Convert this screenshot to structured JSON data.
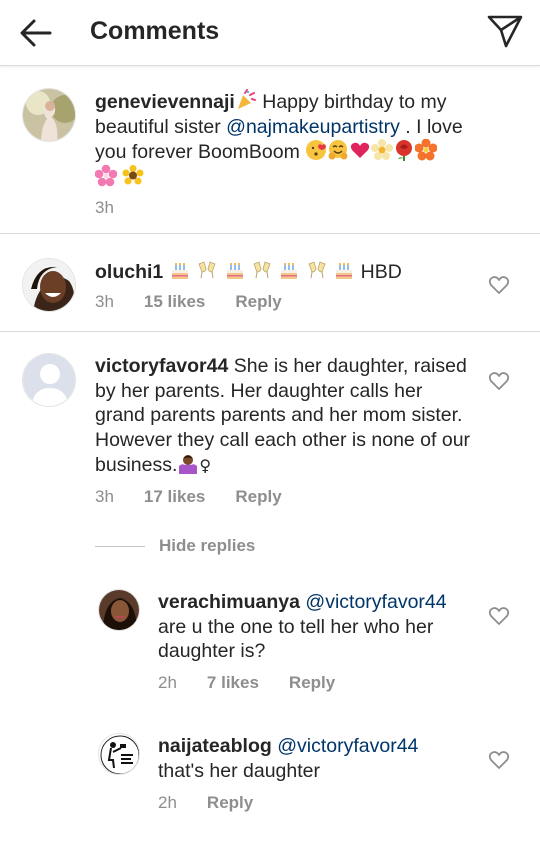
{
  "header": {
    "title": "Comments"
  },
  "caption": {
    "username": "genevievennaji",
    "text_before": " Happy birthday to my beautiful sister ",
    "mention": "@najmakeupartistry",
    "text_after": " . I love you forever BoomBoom ",
    "time": "3h"
  },
  "comments": [
    {
      "username": "oluchi1",
      "text": " HBD",
      "time": "3h",
      "likes": "15 likes",
      "reply": "Reply"
    },
    {
      "username": "victoryfavor44",
      "text": " She is her daughter, raised by her parents. Her daughter calls her grand parents parents and her mom sister. However they call each other is none of our business.",
      "time": "3h",
      "likes": "17 likes",
      "reply": "Reply"
    }
  ],
  "hide_replies": "Hide replies",
  "replies": [
    {
      "username": "verachimuanya",
      "mention": "@victoryfavor44",
      "text": "are u the one to tell her who her daughter is?",
      "time": "2h",
      "likes": "7 likes",
      "reply": "Reply"
    },
    {
      "username": "naijateablog",
      "mention": "@victoryfavor44",
      "text": "that's her daughter",
      "time": "2h",
      "reply": "Reply"
    }
  ],
  "icons": {
    "back": "arrow-left-icon",
    "send": "paper-plane-icon",
    "like": "heart-outline-icon"
  },
  "colors": {
    "text": "#262626",
    "muted": "#8e8e8e",
    "mention": "#003569",
    "divider": "#dbdbdb"
  }
}
